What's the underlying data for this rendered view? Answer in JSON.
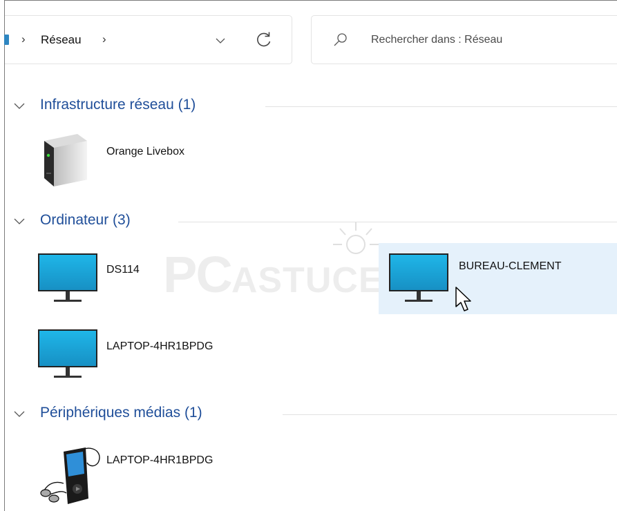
{
  "address_bar": {
    "crumb": "Réseau",
    "separator": "›"
  },
  "search": {
    "placeholder": "Rechercher dans : Réseau"
  },
  "watermark": {
    "pc": "PC",
    "astuces": "ASTUCES"
  },
  "groups": [
    {
      "label": "Infrastructure réseau (1)",
      "items": [
        "Orange Livebox"
      ]
    },
    {
      "label": "Ordinateur (3)",
      "items": [
        "DS114",
        "BUREAU-CLEMENT",
        "LAPTOP-4HR1BPDG"
      ]
    },
    {
      "label": "Périphériques médias (1)",
      "items": [
        "LAPTOP-4HR1BPDG"
      ]
    }
  ],
  "colors": {
    "group_header": "#1f4e99",
    "selection": "#e5f1fb",
    "monitor_screen": "#1aa5d8"
  },
  "icons": {
    "router": "router-icon",
    "computer": "monitor-icon",
    "media": "media-player-icon"
  }
}
